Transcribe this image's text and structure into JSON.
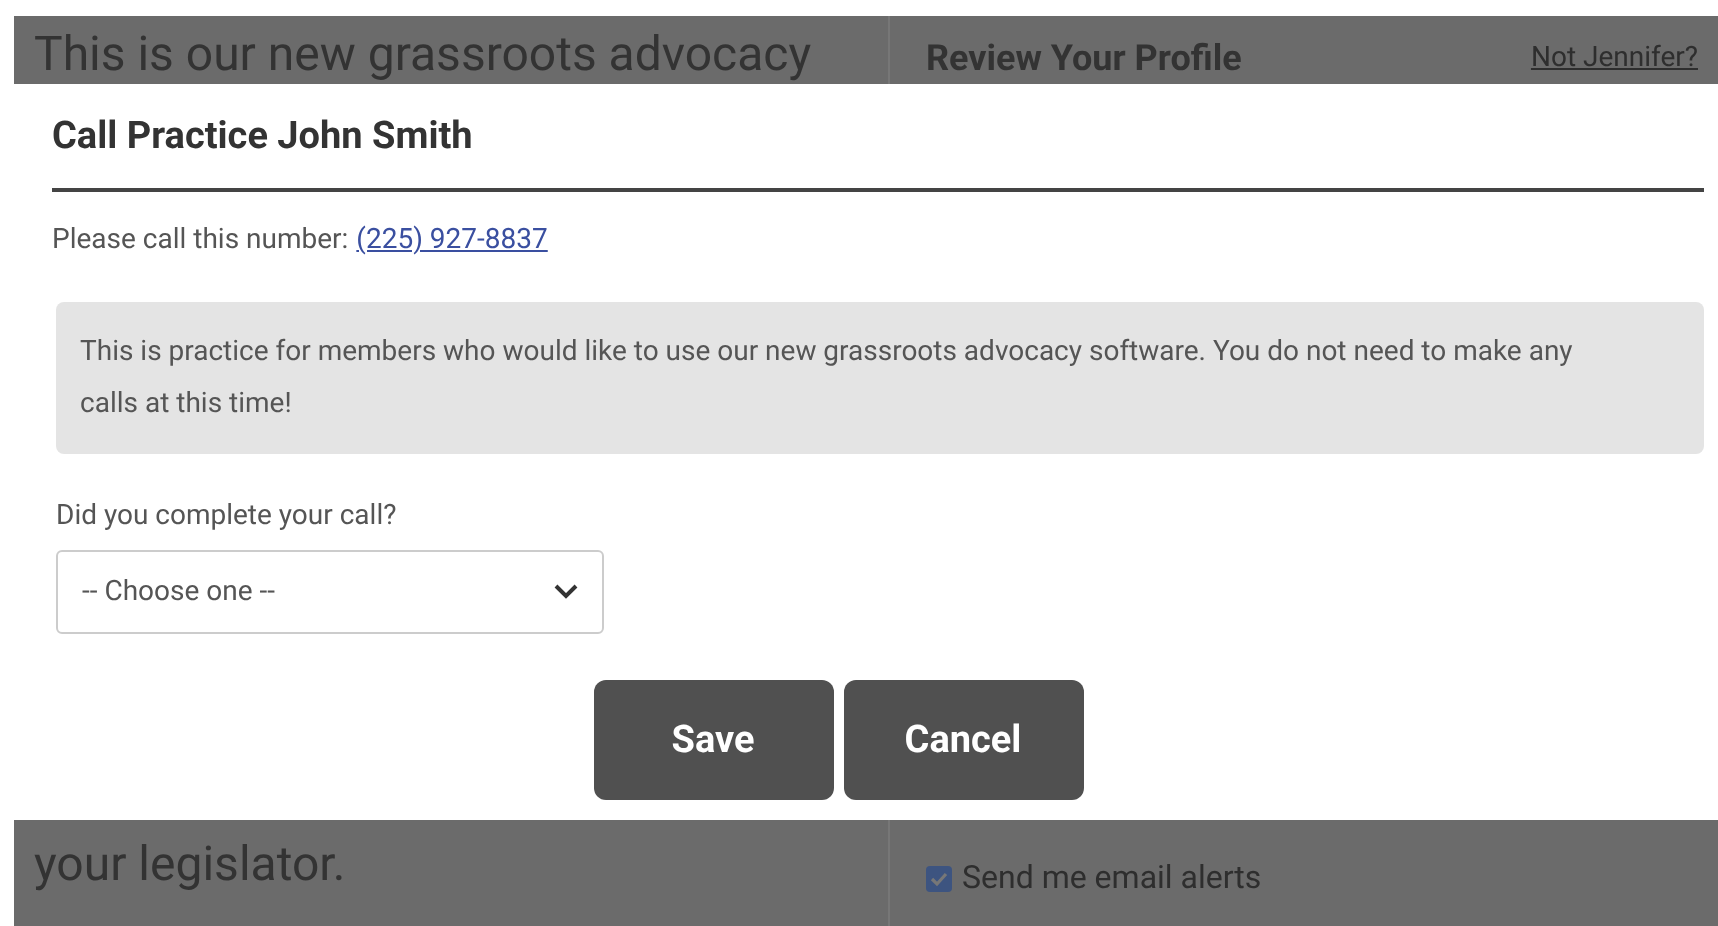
{
  "background_page": {
    "left_heading_top": "This is our new grassroots advocacy",
    "left_heading_bottom": "your legislator.",
    "right_title": "Review Your Profile",
    "right_link": "Not Jennifer?",
    "checkboxes": [
      {
        "label": "Send me email alerts",
        "checked": true
      }
    ]
  },
  "modal": {
    "title": "Call Practice John Smith",
    "call_prompt": "Please call this number:",
    "phone_link": "(225) 927-8837",
    "notice": "This is practice for members who would like to use our new grassroots advocacy software. You do not need to make any calls at this time!",
    "question": "Did you complete your call?",
    "select": {
      "value": "-- Choose one --"
    },
    "buttons": [
      "Save",
      "Cancel"
    ]
  }
}
